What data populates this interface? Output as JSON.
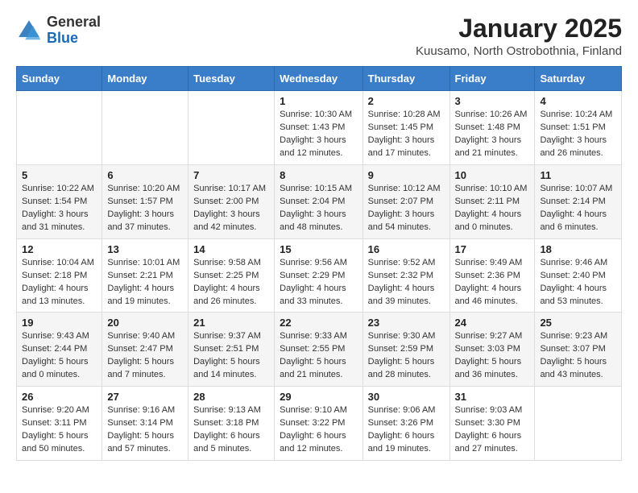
{
  "header": {
    "logo_general": "General",
    "logo_blue": "Blue",
    "month_title": "January 2025",
    "location": "Kuusamo, North Ostrobothnia, Finland"
  },
  "weekdays": [
    "Sunday",
    "Monday",
    "Tuesday",
    "Wednesday",
    "Thursday",
    "Friday",
    "Saturday"
  ],
  "weeks": [
    [
      {
        "day": "",
        "sunrise": "",
        "sunset": "",
        "daylight": ""
      },
      {
        "day": "",
        "sunrise": "",
        "sunset": "",
        "daylight": ""
      },
      {
        "day": "",
        "sunrise": "",
        "sunset": "",
        "daylight": ""
      },
      {
        "day": "1",
        "sunrise": "Sunrise: 10:30 AM",
        "sunset": "Sunset: 1:43 PM",
        "daylight": "Daylight: 3 hours and 12 minutes."
      },
      {
        "day": "2",
        "sunrise": "Sunrise: 10:28 AM",
        "sunset": "Sunset: 1:45 PM",
        "daylight": "Daylight: 3 hours and 17 minutes."
      },
      {
        "day": "3",
        "sunrise": "Sunrise: 10:26 AM",
        "sunset": "Sunset: 1:48 PM",
        "daylight": "Daylight: 3 hours and 21 minutes."
      },
      {
        "day": "4",
        "sunrise": "Sunrise: 10:24 AM",
        "sunset": "Sunset: 1:51 PM",
        "daylight": "Daylight: 3 hours and 26 minutes."
      }
    ],
    [
      {
        "day": "5",
        "sunrise": "Sunrise: 10:22 AM",
        "sunset": "Sunset: 1:54 PM",
        "daylight": "Daylight: 3 hours and 31 minutes."
      },
      {
        "day": "6",
        "sunrise": "Sunrise: 10:20 AM",
        "sunset": "Sunset: 1:57 PM",
        "daylight": "Daylight: 3 hours and 37 minutes."
      },
      {
        "day": "7",
        "sunrise": "Sunrise: 10:17 AM",
        "sunset": "Sunset: 2:00 PM",
        "daylight": "Daylight: 3 hours and 42 minutes."
      },
      {
        "day": "8",
        "sunrise": "Sunrise: 10:15 AM",
        "sunset": "Sunset: 2:04 PM",
        "daylight": "Daylight: 3 hours and 48 minutes."
      },
      {
        "day": "9",
        "sunrise": "Sunrise: 10:12 AM",
        "sunset": "Sunset: 2:07 PM",
        "daylight": "Daylight: 3 hours and 54 minutes."
      },
      {
        "day": "10",
        "sunrise": "Sunrise: 10:10 AM",
        "sunset": "Sunset: 2:11 PM",
        "daylight": "Daylight: 4 hours and 0 minutes."
      },
      {
        "day": "11",
        "sunrise": "Sunrise: 10:07 AM",
        "sunset": "Sunset: 2:14 PM",
        "daylight": "Daylight: 4 hours and 6 minutes."
      }
    ],
    [
      {
        "day": "12",
        "sunrise": "Sunrise: 10:04 AM",
        "sunset": "Sunset: 2:18 PM",
        "daylight": "Daylight: 4 hours and 13 minutes."
      },
      {
        "day": "13",
        "sunrise": "Sunrise: 10:01 AM",
        "sunset": "Sunset: 2:21 PM",
        "daylight": "Daylight: 4 hours and 19 minutes."
      },
      {
        "day": "14",
        "sunrise": "Sunrise: 9:58 AM",
        "sunset": "Sunset: 2:25 PM",
        "daylight": "Daylight: 4 hours and 26 minutes."
      },
      {
        "day": "15",
        "sunrise": "Sunrise: 9:56 AM",
        "sunset": "Sunset: 2:29 PM",
        "daylight": "Daylight: 4 hours and 33 minutes."
      },
      {
        "day": "16",
        "sunrise": "Sunrise: 9:52 AM",
        "sunset": "Sunset: 2:32 PM",
        "daylight": "Daylight: 4 hours and 39 minutes."
      },
      {
        "day": "17",
        "sunrise": "Sunrise: 9:49 AM",
        "sunset": "Sunset: 2:36 PM",
        "daylight": "Daylight: 4 hours and 46 minutes."
      },
      {
        "day": "18",
        "sunrise": "Sunrise: 9:46 AM",
        "sunset": "Sunset: 2:40 PM",
        "daylight": "Daylight: 4 hours and 53 minutes."
      }
    ],
    [
      {
        "day": "19",
        "sunrise": "Sunrise: 9:43 AM",
        "sunset": "Sunset: 2:44 PM",
        "daylight": "Daylight: 5 hours and 0 minutes."
      },
      {
        "day": "20",
        "sunrise": "Sunrise: 9:40 AM",
        "sunset": "Sunset: 2:47 PM",
        "daylight": "Daylight: 5 hours and 7 minutes."
      },
      {
        "day": "21",
        "sunrise": "Sunrise: 9:37 AM",
        "sunset": "Sunset: 2:51 PM",
        "daylight": "Daylight: 5 hours and 14 minutes."
      },
      {
        "day": "22",
        "sunrise": "Sunrise: 9:33 AM",
        "sunset": "Sunset: 2:55 PM",
        "daylight": "Daylight: 5 hours and 21 minutes."
      },
      {
        "day": "23",
        "sunrise": "Sunrise: 9:30 AM",
        "sunset": "Sunset: 2:59 PM",
        "daylight": "Daylight: 5 hours and 28 minutes."
      },
      {
        "day": "24",
        "sunrise": "Sunrise: 9:27 AM",
        "sunset": "Sunset: 3:03 PM",
        "daylight": "Daylight: 5 hours and 36 minutes."
      },
      {
        "day": "25",
        "sunrise": "Sunrise: 9:23 AM",
        "sunset": "Sunset: 3:07 PM",
        "daylight": "Daylight: 5 hours and 43 minutes."
      }
    ],
    [
      {
        "day": "26",
        "sunrise": "Sunrise: 9:20 AM",
        "sunset": "Sunset: 3:11 PM",
        "daylight": "Daylight: 5 hours and 50 minutes."
      },
      {
        "day": "27",
        "sunrise": "Sunrise: 9:16 AM",
        "sunset": "Sunset: 3:14 PM",
        "daylight": "Daylight: 5 hours and 57 minutes."
      },
      {
        "day": "28",
        "sunrise": "Sunrise: 9:13 AM",
        "sunset": "Sunset: 3:18 PM",
        "daylight": "Daylight: 6 hours and 5 minutes."
      },
      {
        "day": "29",
        "sunrise": "Sunrise: 9:10 AM",
        "sunset": "Sunset: 3:22 PM",
        "daylight": "Daylight: 6 hours and 12 minutes."
      },
      {
        "day": "30",
        "sunrise": "Sunrise: 9:06 AM",
        "sunset": "Sunset: 3:26 PM",
        "daylight": "Daylight: 6 hours and 19 minutes."
      },
      {
        "day": "31",
        "sunrise": "Sunrise: 9:03 AM",
        "sunset": "Sunset: 3:30 PM",
        "daylight": "Daylight: 6 hours and 27 minutes."
      },
      {
        "day": "",
        "sunrise": "",
        "sunset": "",
        "daylight": ""
      }
    ]
  ]
}
